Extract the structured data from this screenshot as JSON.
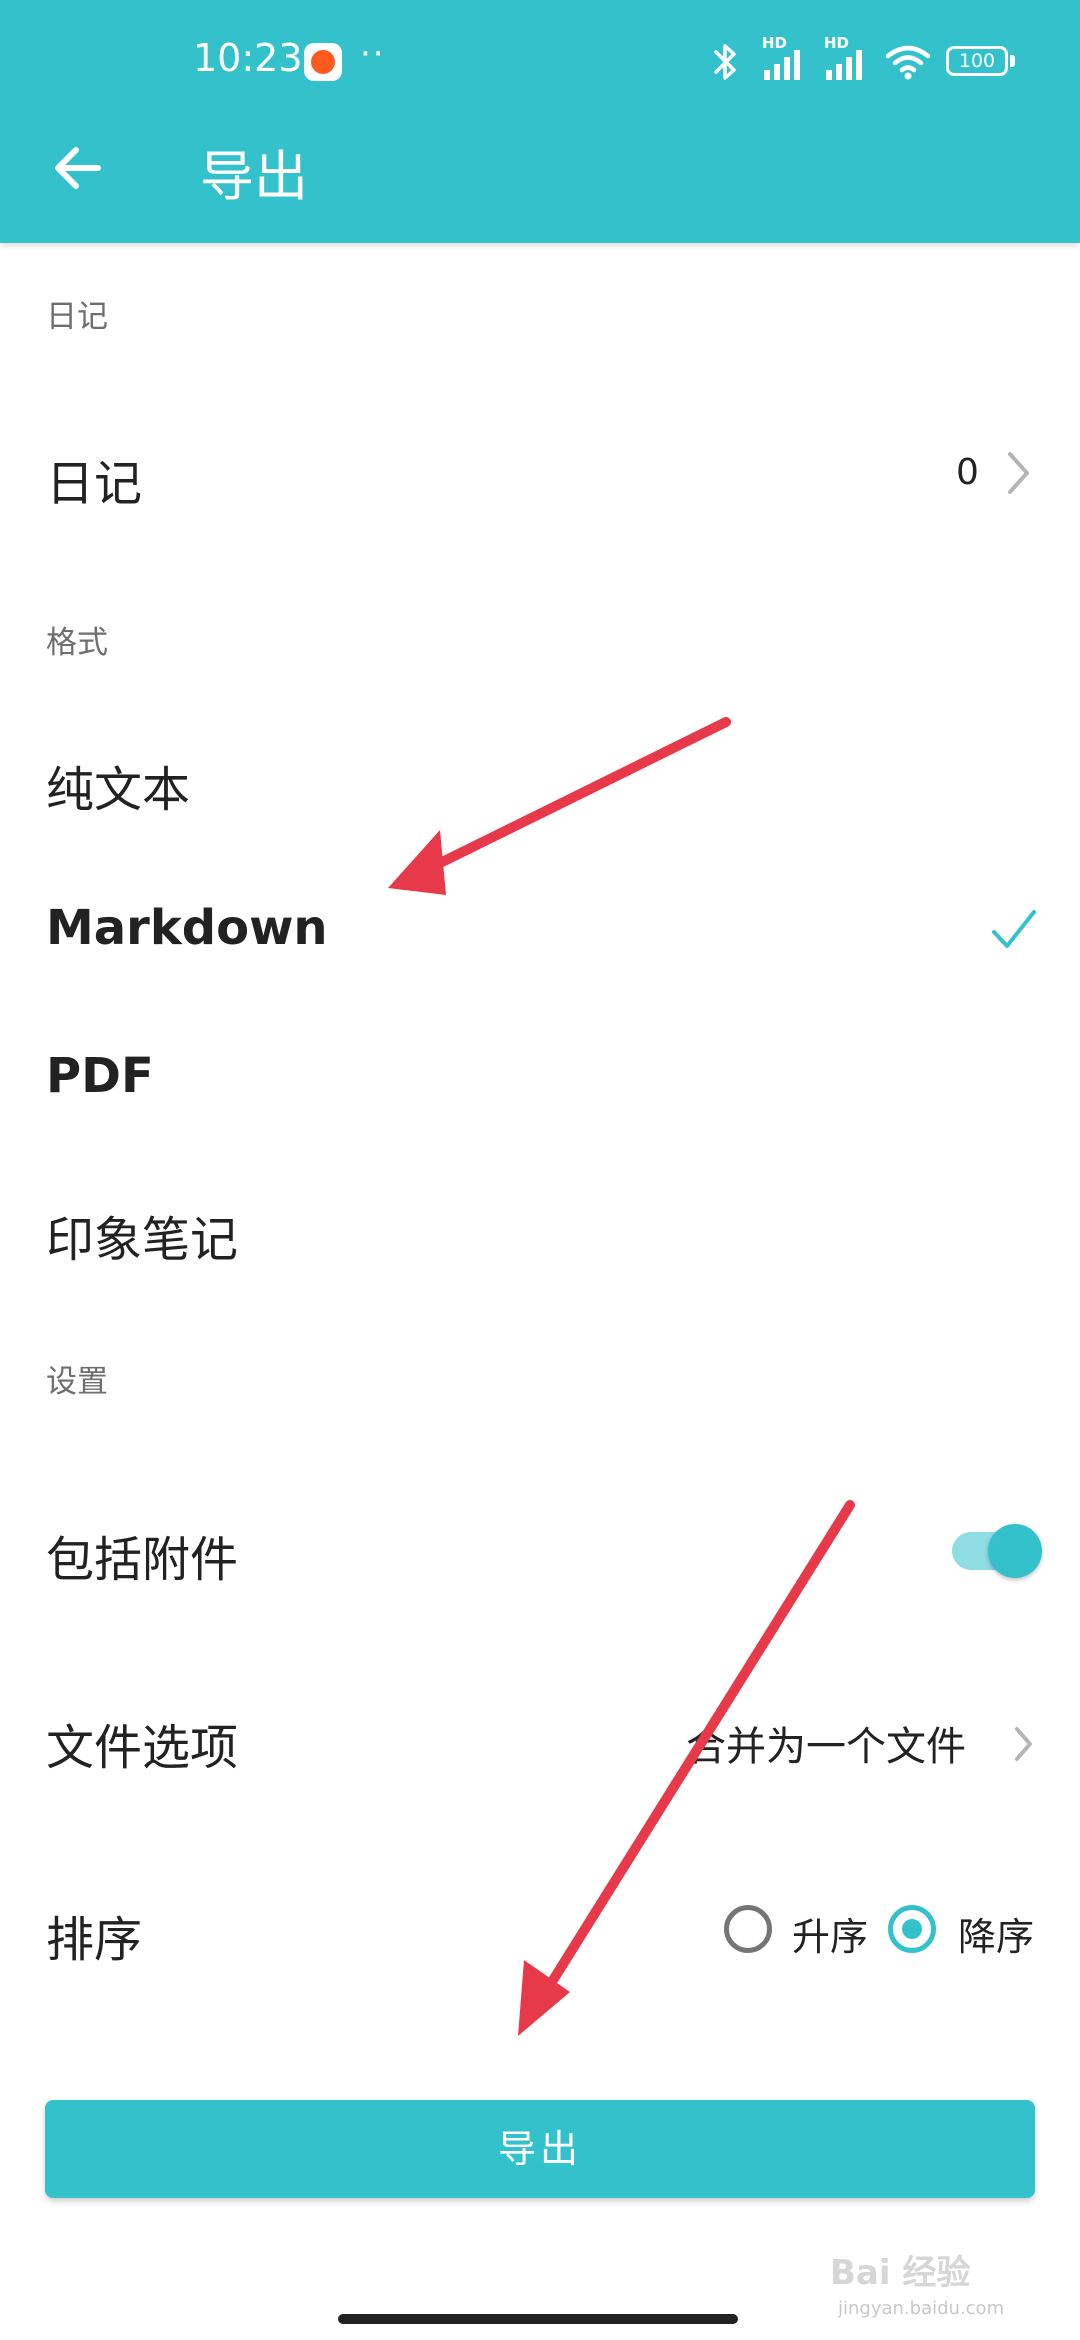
{
  "status_bar": {
    "time": "10:23",
    "dots": "··",
    "network_1": "HD",
    "network_2": "HD",
    "battery": "100"
  },
  "app_bar": {
    "title": "导出"
  },
  "sections": {
    "diary": "日记",
    "format": "格式",
    "settings": "设置"
  },
  "diary_row": {
    "label": "日记",
    "count": "0"
  },
  "formats": [
    {
      "label": "纯文本",
      "selected": false
    },
    {
      "label": "Markdown",
      "selected": true
    },
    {
      "label": "PDF",
      "selected": false
    },
    {
      "label": "印象笔记",
      "selected": false
    }
  ],
  "settings": {
    "include_attachments": {
      "label": "包括附件",
      "enabled": true
    },
    "file_options": {
      "label": "文件选项",
      "value": "合并为一个文件"
    },
    "sort": {
      "label": "排序",
      "options": [
        "升序",
        "降序"
      ],
      "selected": "降序"
    }
  },
  "export_button": "导出",
  "watermark": {
    "text": "Bai 经验",
    "sub": "jingyan.baidu.com"
  },
  "colors": {
    "accent": "#33c2cb",
    "annotation_arrow": "#e8394a"
  }
}
